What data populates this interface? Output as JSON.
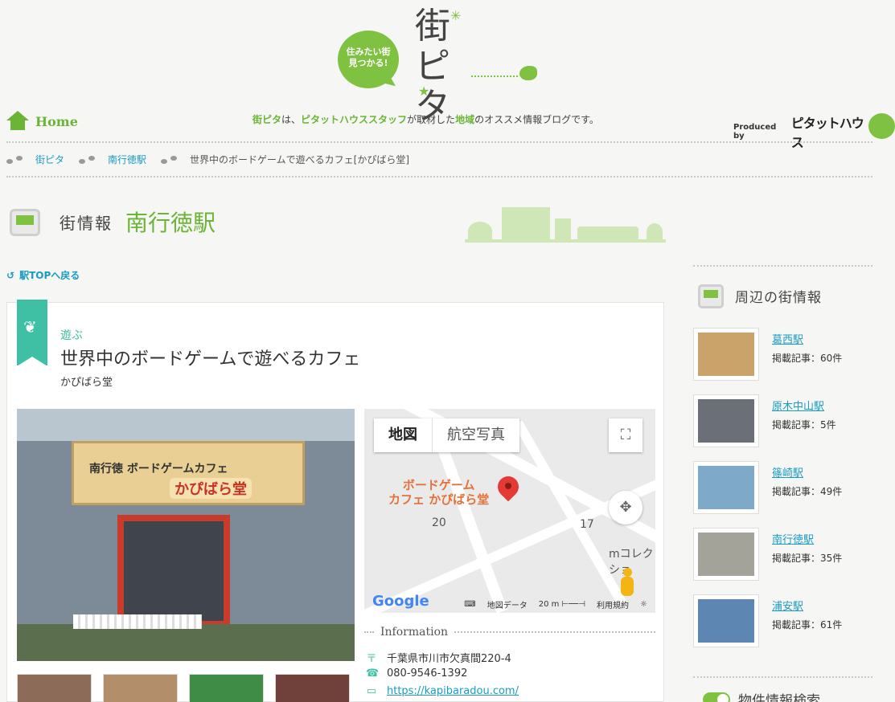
{
  "header": {
    "bubble_text": "住みたい街\n見つかる!",
    "logo_text": "街ピタ",
    "home_label": "Home",
    "tagline": {
      "p1": "街ピタ",
      "p2": "は、",
      "p3": "ピタットハウススタッフ",
      "p4": "が取材した",
      "p5": "地域",
      "p6": "のオススメ情報ブログです。"
    },
    "produced_by": "Produced by",
    "brand": "ピタットハウス"
  },
  "breadcrumb": {
    "items": [
      "街ピタ",
      "南行徳駅",
      "世界中のボードゲームで遊べるカフェ[かぴばら堂]"
    ]
  },
  "page_title": {
    "label": "街情報",
    "station": "南行徳駅"
  },
  "back_link": "駅TOPへ戻る",
  "article": {
    "category": "遊ぶ",
    "title": "世界中のボードゲームで遊べるカフェ",
    "subtitle": "かぴばら堂",
    "photo_sign_top": "南行徳 ボードゲームカフェ",
    "photo_sign_name": "かぴばら堂"
  },
  "map": {
    "tabs": [
      "地図",
      "航空写真"
    ],
    "place_label": "ボードゲーム\nカフェ かぴばら堂",
    "numbers": [
      "20",
      "17"
    ],
    "side_label": "mコレクショ",
    "footer": {
      "google": "Google",
      "data": "地図データ",
      "scale": "20 m",
      "terms": "利用規約"
    }
  },
  "info": {
    "heading": "Information",
    "address": "千葉県市川市欠真間220-4",
    "phone": "080-9546-1392",
    "url": "https://kapibaradou.com/"
  },
  "sidebar": {
    "title": "周辺の街情報",
    "items": [
      {
        "name": "葛西駅",
        "count": "掲載記事：60件",
        "color": "#c9a36a"
      },
      {
        "name": "原木中山駅",
        "count": "掲載記事：5件",
        "color": "#6b6f78"
      },
      {
        "name": "篠崎駅",
        "count": "掲載記事：49件",
        "color": "#7fa9c9"
      },
      {
        "name": "南行徳駅",
        "count": "掲載記事：35件",
        "color": "#a3a39a"
      },
      {
        "name": "浦安駅",
        "count": "掲載記事：61件",
        "color": "#5d86b3"
      }
    ],
    "bottom_label": "物件情報検索"
  },
  "colors": {
    "accent_green": "#6bb536",
    "teal": "#3fbfa4",
    "link_blue": "#1a9bc4"
  }
}
